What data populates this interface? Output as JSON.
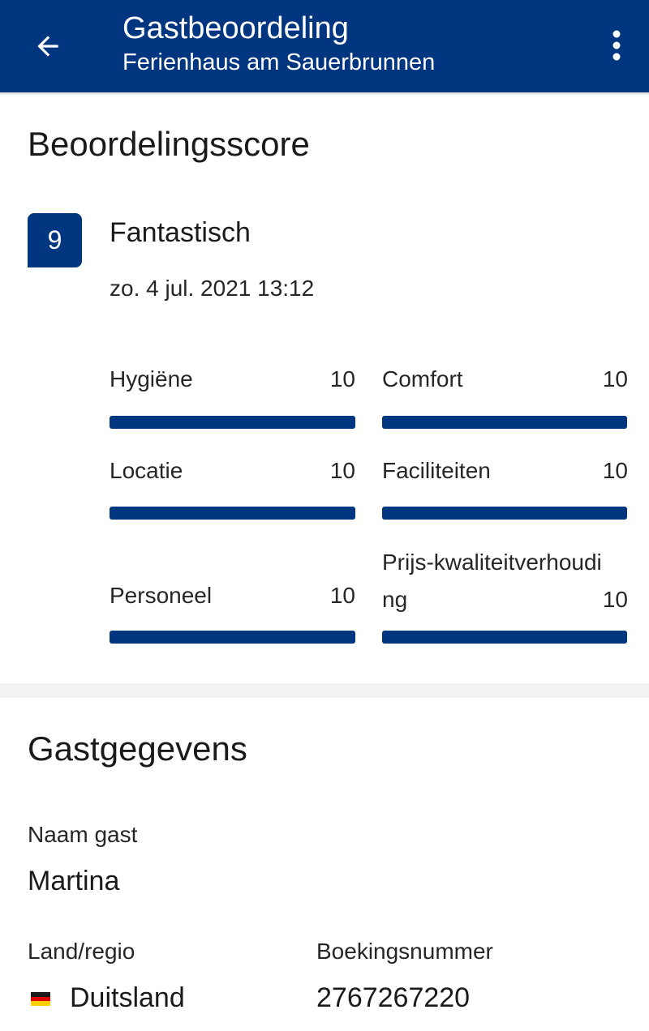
{
  "header": {
    "title": "Gastbeoordeling",
    "subtitle": "Ferienhaus am Sauerbrunnen",
    "back_icon": "arrow-left-icon",
    "more_icon": "more-vertical-icon",
    "background_color": "#003580"
  },
  "score_section": {
    "title": "Beoordelingsscore",
    "score": "9",
    "label": "Fantastisch",
    "date": "zo. 4 jul. 2021 13:12",
    "categories": [
      {
        "label": "Hygiëne",
        "value": "10",
        "fraction": 1.0
      },
      {
        "label": "Comfort",
        "value": "10",
        "fraction": 1.0
      },
      {
        "label": "Locatie",
        "value": "10",
        "fraction": 1.0
      },
      {
        "label": "Faciliteiten",
        "value": "10",
        "fraction": 1.0
      },
      {
        "label": "Personeel",
        "value": "10",
        "fraction": 1.0
      },
      {
        "label": "Prijs-kwaliteitverhouding",
        "value": "10",
        "fraction": 1.0
      }
    ]
  },
  "guest_section": {
    "title": "Gastgegevens",
    "name_label": "Naam gast",
    "name_value": "Martina",
    "country_label": "Land/regio",
    "country_value": "Duitsland",
    "country_flag_icon": "germany-flag-icon",
    "booking_label": "Boekingsnummer",
    "booking_value": "2767267220"
  },
  "colors": {
    "brand": "#003580",
    "divider": "#f2f2f2"
  }
}
